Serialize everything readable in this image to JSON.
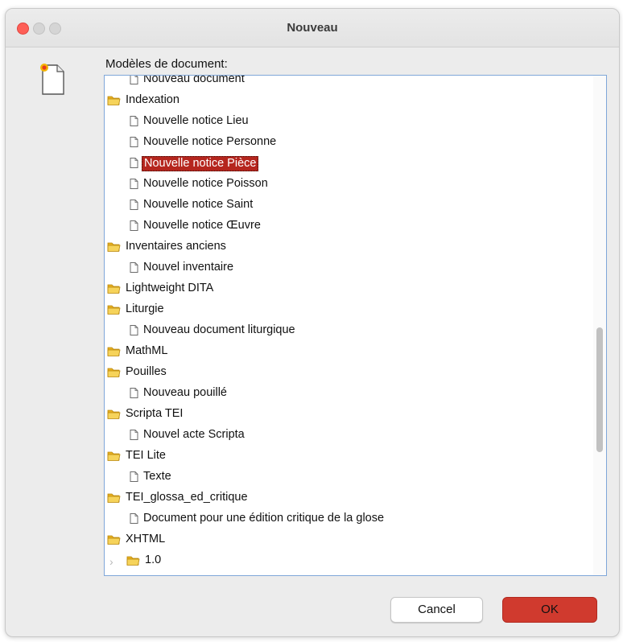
{
  "window": {
    "title": "Nouveau"
  },
  "tree_label": "Modèles de document:",
  "rows": [
    {
      "type": "item",
      "label": "Nouveau document",
      "icon": "document-icon"
    },
    {
      "type": "folder",
      "label": "Indexation",
      "icon": "folder-icon"
    },
    {
      "type": "item",
      "label": "Nouvelle notice Lieu",
      "icon": "document-icon"
    },
    {
      "type": "item",
      "label": "Nouvelle notice Personne",
      "icon": "document-icon"
    },
    {
      "type": "item",
      "label": "Nouvelle notice Pièce",
      "icon": "document-icon",
      "selected": true
    },
    {
      "type": "item",
      "label": "Nouvelle notice Poisson",
      "icon": "document-icon"
    },
    {
      "type": "item",
      "label": "Nouvelle notice Saint",
      "icon": "document-icon"
    },
    {
      "type": "item",
      "label": "Nouvelle notice Œuvre",
      "icon": "document-icon"
    },
    {
      "type": "folder",
      "label": "Inventaires anciens",
      "icon": "folder-icon"
    },
    {
      "type": "item",
      "label": "Nouvel inventaire",
      "icon": "document-icon"
    },
    {
      "type": "folder",
      "label": "Lightweight DITA",
      "icon": "folder-icon"
    },
    {
      "type": "folder",
      "label": "Liturgie",
      "icon": "folder-icon"
    },
    {
      "type": "item",
      "label": "Nouveau document liturgique",
      "icon": "document-icon"
    },
    {
      "type": "folder",
      "label": "MathML",
      "icon": "folder-icon"
    },
    {
      "type": "folder",
      "label": "Pouilles",
      "icon": "folder-icon"
    },
    {
      "type": "item",
      "label": "Nouveau pouillé",
      "icon": "document-icon"
    },
    {
      "type": "folder",
      "label": "Scripta TEI",
      "icon": "folder-icon"
    },
    {
      "type": "item",
      "label": "Nouvel acte Scripta",
      "icon": "document-icon"
    },
    {
      "type": "folder",
      "label": "TEI Lite",
      "icon": "folder-icon"
    },
    {
      "type": "item",
      "label": "Texte",
      "icon": "document-icon"
    },
    {
      "type": "folder",
      "label": "TEI_glossa_ed_critique",
      "icon": "folder-icon"
    },
    {
      "type": "item",
      "label": "Document pour une édition critique de la glose",
      "icon": "document-icon"
    },
    {
      "type": "folder",
      "label": "XHTML",
      "icon": "folder-icon"
    },
    {
      "type": "subfolder",
      "label": "1.0",
      "icon": "folder-icon",
      "collapsed": true
    }
  ],
  "buttons": {
    "cancel": "Cancel",
    "ok": "OK"
  },
  "colors": {
    "selection": "#b5261e",
    "ok_button": "#d03a2e",
    "close_light": "#fe5f57",
    "folder": "#f2c530"
  }
}
